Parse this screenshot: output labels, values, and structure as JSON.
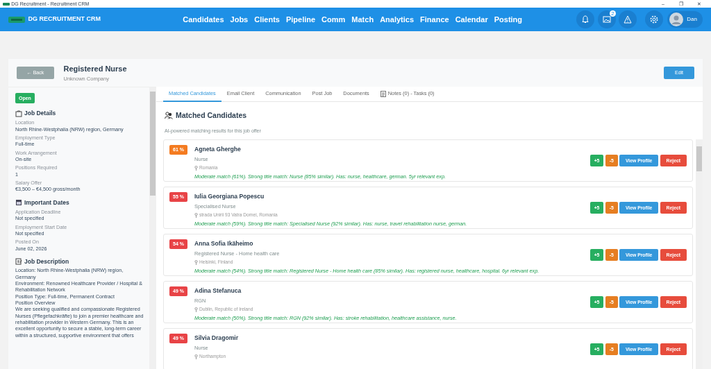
{
  "window": {
    "title": "DG Recruitment - Recruitment CRM",
    "controls": [
      "–",
      "❐",
      "✕"
    ]
  },
  "navbar": {
    "brand": "DG RECRUITMENT CRM",
    "links": [
      "Candidates",
      "Jobs",
      "Clients",
      "Pipeline",
      "Comm",
      "Match",
      "Analytics",
      "Finance",
      "Calendar",
      "Posting"
    ],
    "notification_count": "2",
    "user": "Dan"
  },
  "header": {
    "back": "← Back",
    "title": "Registered Nurse",
    "company": "Unknown Company",
    "edit": "Edit"
  },
  "sidebar": {
    "status": "Open",
    "sections": [
      {
        "kind": "fields",
        "title": "Job Details",
        "fields": [
          {
            "label": "Location",
            "value": "North Rhine-Westphalia (NRW) region, Germany"
          },
          {
            "label": "Employment Type",
            "value": "Full-time"
          },
          {
            "label": "Work Arrangement",
            "value": "On-site"
          },
          {
            "label": "Positions Required",
            "value": "1"
          },
          {
            "label": "Salary Offer",
            "value": "€3,500 – €4,500 gross/month"
          }
        ]
      },
      {
        "kind": "fields",
        "title": "Important Dates",
        "fields": [
          {
            "label": "Application Deadline",
            "value": "Not specified"
          },
          {
            "label": "Employment Start Date",
            "value": "Not specified"
          },
          {
            "label": "Posted On",
            "value": "June 02, 2026"
          }
        ]
      },
      {
        "kind": "text",
        "title": "Job Description",
        "lines": [
          "Location: North Rhine-Westphalia (NRW) region, Germany",
          "Environment: Renowned Healthcare Provider / Hospital & Rehabilitation Network",
          "Position Type: Full-time, Permanent Contract",
          "Position Overview",
          "We are seeking qualified and compassionate Registered Nurses (Pflegefachkräfte) to join a premier healthcare and rehabilitation provider in Western Germany. This is an excellent opportunity to secure a stable, long-term career within a structured, supportive environment that offers"
        ]
      }
    ]
  },
  "tabs": [
    {
      "label": "Matched Candidates",
      "selected": true
    },
    {
      "label": "Email Client",
      "selected": false
    },
    {
      "label": "Communication",
      "selected": false
    },
    {
      "label": "Post Job",
      "selected": false
    },
    {
      "label": "Documents",
      "selected": false
    },
    {
      "label": "Notes (0) - Tasks (0)",
      "selected": false,
      "kind": "notes"
    }
  ],
  "matches": {
    "title": "Matched Candidates",
    "subtitle": "AI-powered matching results for this job offer",
    "candidates": [
      {
        "score": "61 %",
        "color": "#f47b20",
        "name": "Agneta Gherghe",
        "role": "Nurse",
        "location": "Romania",
        "reason": "Moderate match (61%). Strong title match: Nurse (85% similar). Has: nurse, healthcare, german. 5yr relevant exp.",
        "actions": {
          "plus": "+5",
          "minus": "-5",
          "view": "View Profile",
          "reject": "Reject"
        }
      },
      {
        "score": "55 %",
        "color": "#e84346",
        "name": "Iulia Georgiana Popescu",
        "role": "Specialised Nurse",
        "location": "strada Unirii 93 Vatra Dornei, Romania",
        "reason": "Moderate match (59%). Strong title match: Specialised Nurse (92% similar). Has: nurse, travel rehabilitation nurse, german.",
        "actions": {
          "plus": "+5",
          "minus": "-5",
          "view": "View Profile",
          "reject": "Reject"
        }
      },
      {
        "score": "54 %",
        "color": "#e84346",
        "name": "Anna Sofia Ikäheimo",
        "role": "Registered Nurse - Home health care",
        "location": "Helsinki, Finland",
        "reason": "Moderate match (54%). Strong title match: Registered Nurse - Home health care (85% similar). Has: registered nurse, healthcare, hospital. 6yr relevant exp.",
        "actions": {
          "plus": "+5",
          "minus": "-5",
          "view": "View Profile",
          "reject": "Reject"
        }
      },
      {
        "score": "49 %",
        "color": "#e84346",
        "name": "Adina Stefanuca",
        "role": "RGN",
        "location": "Dublin, Republic of Ireland",
        "reason": "Moderate match (50%). Strong title match: RGN (92% similar). Has: stroke rehabilitation, healthcare assistance, nurse.",
        "actions": {
          "plus": "+5",
          "minus": "-5",
          "view": "View Profile",
          "reject": "Reject"
        }
      },
      {
        "score": "49 %",
        "color": "#e84346",
        "name": "Silvia Dragomir",
        "role": "Nurse",
        "location": "Northampton",
        "actions": {
          "plus": "+5",
          "minus": "-5",
          "view": "View Profile",
          "reject": "Reject"
        }
      }
    ]
  }
}
